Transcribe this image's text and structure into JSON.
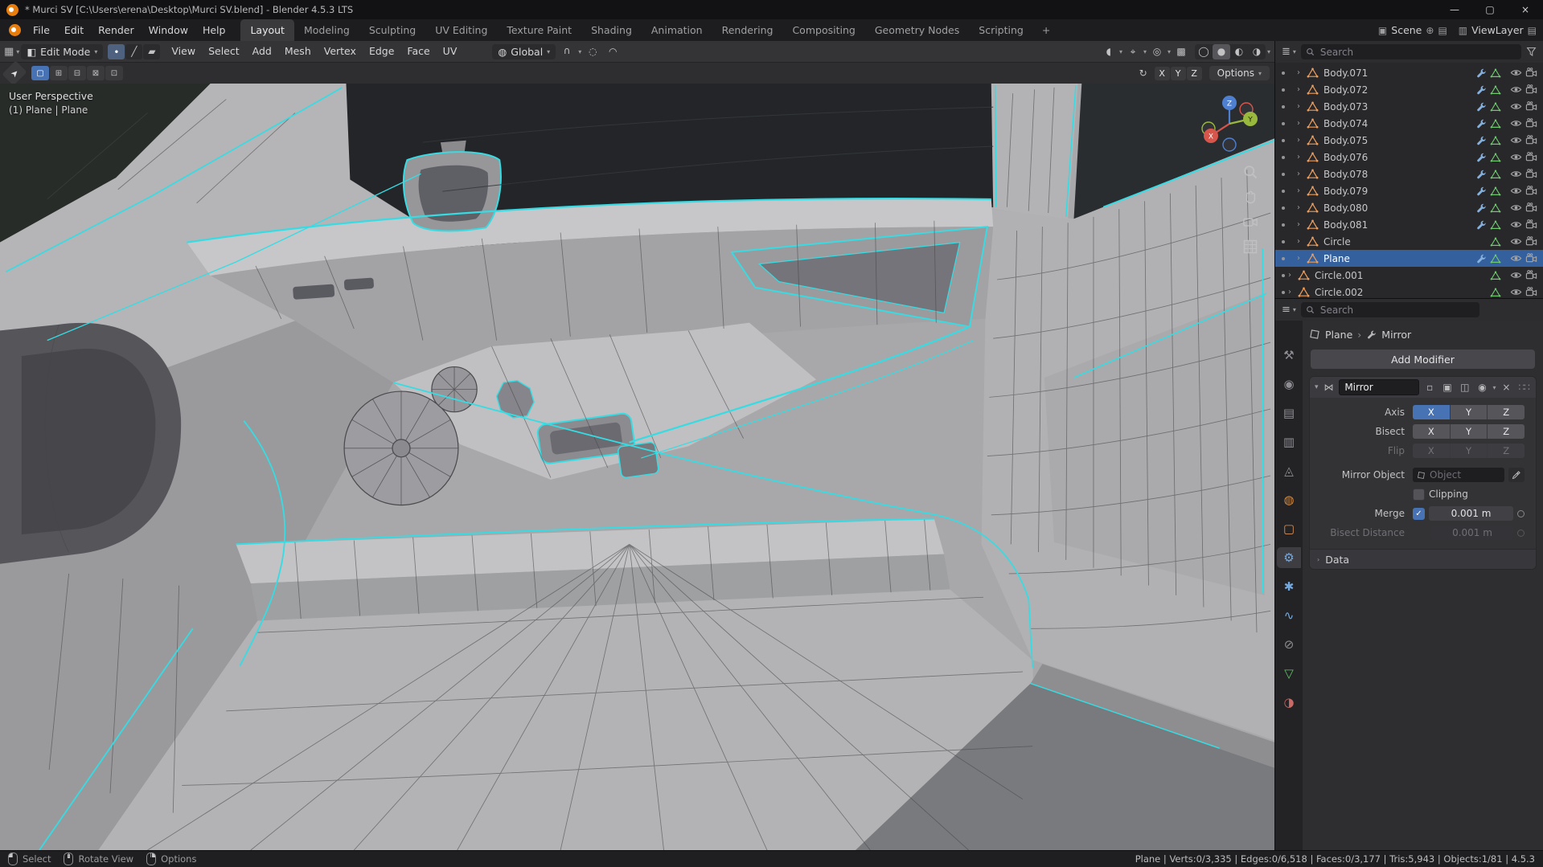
{
  "window": {
    "title": "* Murci SV [C:\\Users\\erena\\Desktop\\Murci SV.blend] - Blender 4.5.3 LTS",
    "controls": {
      "minimize": "—",
      "maximize": "▢",
      "close": "×"
    }
  },
  "topbar": {
    "menus": [
      {
        "label": "File"
      },
      {
        "label": "Edit"
      },
      {
        "label": "Render"
      },
      {
        "label": "Window"
      },
      {
        "label": "Help"
      }
    ],
    "workspaces": [
      {
        "label": "Layout",
        "active": true
      },
      {
        "label": "Modeling"
      },
      {
        "label": "Sculpting"
      },
      {
        "label": "UV Editing"
      },
      {
        "label": "Texture Paint"
      },
      {
        "label": "Shading"
      },
      {
        "label": "Animation"
      },
      {
        "label": "Rendering"
      },
      {
        "label": "Compositing"
      },
      {
        "label": "Geometry Nodes"
      },
      {
        "label": "Scripting"
      }
    ],
    "add_workspace_label": "+",
    "scene_selector": {
      "label": "Scene"
    },
    "view_layer_selector": {
      "label": "ViewLayer"
    }
  },
  "viewport": {
    "header": {
      "mode_label": "Edit Mode",
      "menus": [
        {
          "label": "View"
        },
        {
          "label": "Select"
        },
        {
          "label": "Add"
        },
        {
          "label": "Mesh"
        },
        {
          "label": "Vertex"
        },
        {
          "label": "Edge"
        },
        {
          "label": "Face"
        },
        {
          "label": "UV"
        }
      ],
      "orientation_label": "Global"
    },
    "tool_header": {
      "mirror_axes": [
        {
          "label": "X"
        },
        {
          "label": "Y"
        },
        {
          "label": "Z"
        }
      ],
      "options_label": "Options"
    },
    "overlay": {
      "line1": "User Perspective",
      "line2": "(1) Plane | Plane"
    },
    "gizmo_axes": {
      "x": "X",
      "y": "Y",
      "z": "Z"
    }
  },
  "outliner": {
    "search_placeholder": "Search",
    "items": [
      {
        "label": "Body.071",
        "kind": "body"
      },
      {
        "label": "Body.072",
        "kind": "body"
      },
      {
        "label": "Body.073",
        "kind": "body"
      },
      {
        "label": "Body.074",
        "kind": "body"
      },
      {
        "label": "Body.075",
        "kind": "body"
      },
      {
        "label": "Body.076",
        "kind": "body"
      },
      {
        "label": "Body.078",
        "kind": "body"
      },
      {
        "label": "Body.079",
        "kind": "body"
      },
      {
        "label": "Body.080",
        "kind": "body"
      },
      {
        "label": "Body.081",
        "kind": "body"
      },
      {
        "label": "Circle",
        "kind": "plain"
      },
      {
        "label": "Plane",
        "kind": "body",
        "selected": true
      },
      {
        "label": "Circle.001",
        "kind": "plain",
        "root": true
      },
      {
        "label": "Circle.002",
        "kind": "plain",
        "root": true
      }
    ]
  },
  "properties": {
    "search_placeholder": "Search",
    "tabs": [
      {
        "name": "tool",
        "glyph": "⚒"
      },
      {
        "name": "render",
        "glyph": "◉"
      },
      {
        "name": "output",
        "glyph": "▤"
      },
      {
        "name": "view-layer",
        "glyph": "▥"
      },
      {
        "name": "scene",
        "glyph": "◬"
      },
      {
        "name": "world",
        "glyph": "◍",
        "color": "#cf8a45"
      },
      {
        "name": "object",
        "glyph": "▢",
        "color": "#db9257"
      },
      {
        "name": "modifiers",
        "glyph": "⚙",
        "color": "#74a9e0",
        "active": true
      },
      {
        "name": "particles",
        "glyph": "✱",
        "color": "#74a9e0"
      },
      {
        "name": "physics",
        "glyph": "∿",
        "color": "#74a9e0"
      },
      {
        "name": "constraints",
        "glyph": "⊘"
      },
      {
        "name": "object-data",
        "glyph": "▽",
        "color": "#5fbf66"
      },
      {
        "name": "material",
        "glyph": "◑",
        "color": "#c96a66"
      }
    ],
    "breadcrumb": {
      "object": "Plane",
      "separator": "›",
      "modifier": "Mirror"
    },
    "add_modifier_label": "Add Modifier",
    "modifier": {
      "name": "Mirror",
      "axis_row": {
        "label": "Axis",
        "options": [
          "X",
          "Y",
          "Z"
        ],
        "active": "X"
      },
      "bisect_row": {
        "label": "Bisect",
        "options": [
          "X",
          "Y",
          "Z"
        ]
      },
      "flip_row": {
        "label": "Flip",
        "options": [
          "X",
          "Y",
          "Z"
        ],
        "disabled": true
      },
      "mirror_object_row": {
        "label": "Mirror Object",
        "placeholder": "Object"
      },
      "clipping_row": {
        "label": "Clipping",
        "checked": false
      },
      "merge_row": {
        "label": "Merge",
        "checked": true,
        "value": "0.001 m"
      },
      "bisect_distance_row": {
        "label": "Bisect Distance",
        "value": "0.001 m",
        "disabled": true
      },
      "data_section_label": "Data"
    }
  },
  "statusbar": {
    "hints": [
      {
        "label": "Select",
        "kind": "lmb"
      },
      {
        "label": "Rotate View",
        "kind": "mmb"
      },
      {
        "label": "Options",
        "kind": "rmb"
      }
    ],
    "stats": "Plane | Verts:0/3,335 | Edges:0/6,518 | Faces:0/3,177 | Tris:5,943 | Objects:1/81 | 4.5.3"
  },
  "colors": {
    "accent": "#4772b3",
    "edge_highlight": "#35dce3"
  }
}
